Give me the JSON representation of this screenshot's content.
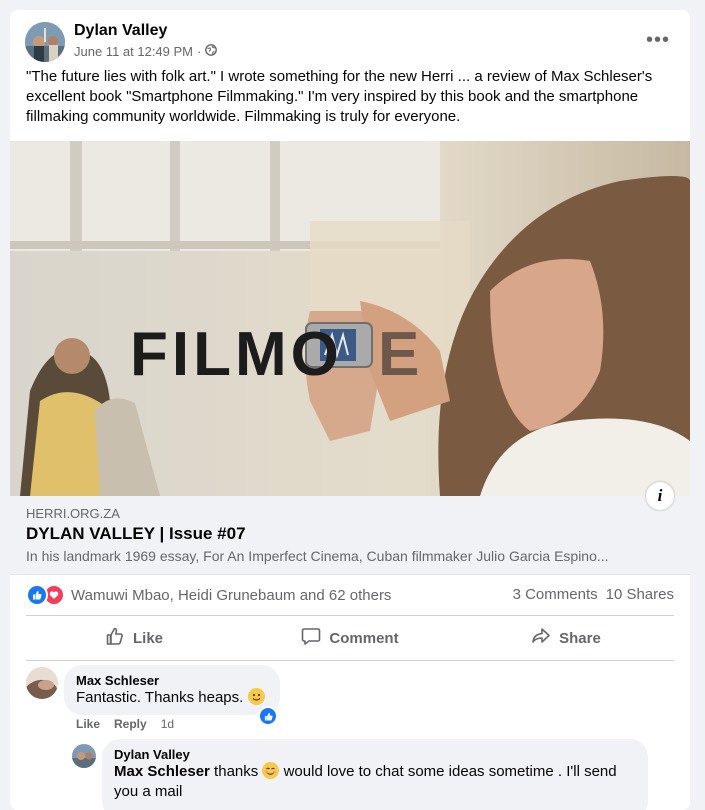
{
  "post": {
    "author": "Dylan Valley",
    "timestamp": "June 11 at 12:49 PM",
    "separator": "·",
    "audience_icon": "globe-icon",
    "more_icon": "more-icon",
    "more_glyph": "•••",
    "text": "\"The future lies with folk art.\" I wrote something for the new Herri ... a review of Max Schleser's excellent book \"Smartphone Filmmaking.\" I'm very inspired by this book and the smartphone fillmaking community worldwide. Filmmaking is truly for everyone.",
    "image_text": "FILMO",
    "info_glyph": "i"
  },
  "link_preview": {
    "domain": "HERRI.ORG.ZA",
    "title": "DYLAN VALLEY | Issue #07",
    "description": "In his landmark 1969 essay, For An Imperfect Cinema, Cuban filmmaker Julio Garcia Espino..."
  },
  "stats": {
    "reaction_names": "Wamuwi Mbao, Heidi Grunebaum and 62 others",
    "comments": "3 Comments",
    "shares": "10 Shares"
  },
  "actions": {
    "like": "Like",
    "comment": "Comment",
    "share": "Share"
  },
  "comments": [
    {
      "author": "Max Schleser",
      "text": "Fantastic. Thanks heaps.",
      "like_label": "Like",
      "reply_label": "Reply",
      "age": "1d"
    },
    {
      "author": "Dylan Valley",
      "mention": "Max Schleser",
      "text_part1": " thanks ",
      "text_part2": " would love to chat some ideas sometime . I'll send you a mail"
    }
  ],
  "colors": {
    "accent": "#1877f2",
    "love": "#f33e58",
    "secondary_text": "#65676b",
    "background": "#f0f2f5"
  }
}
